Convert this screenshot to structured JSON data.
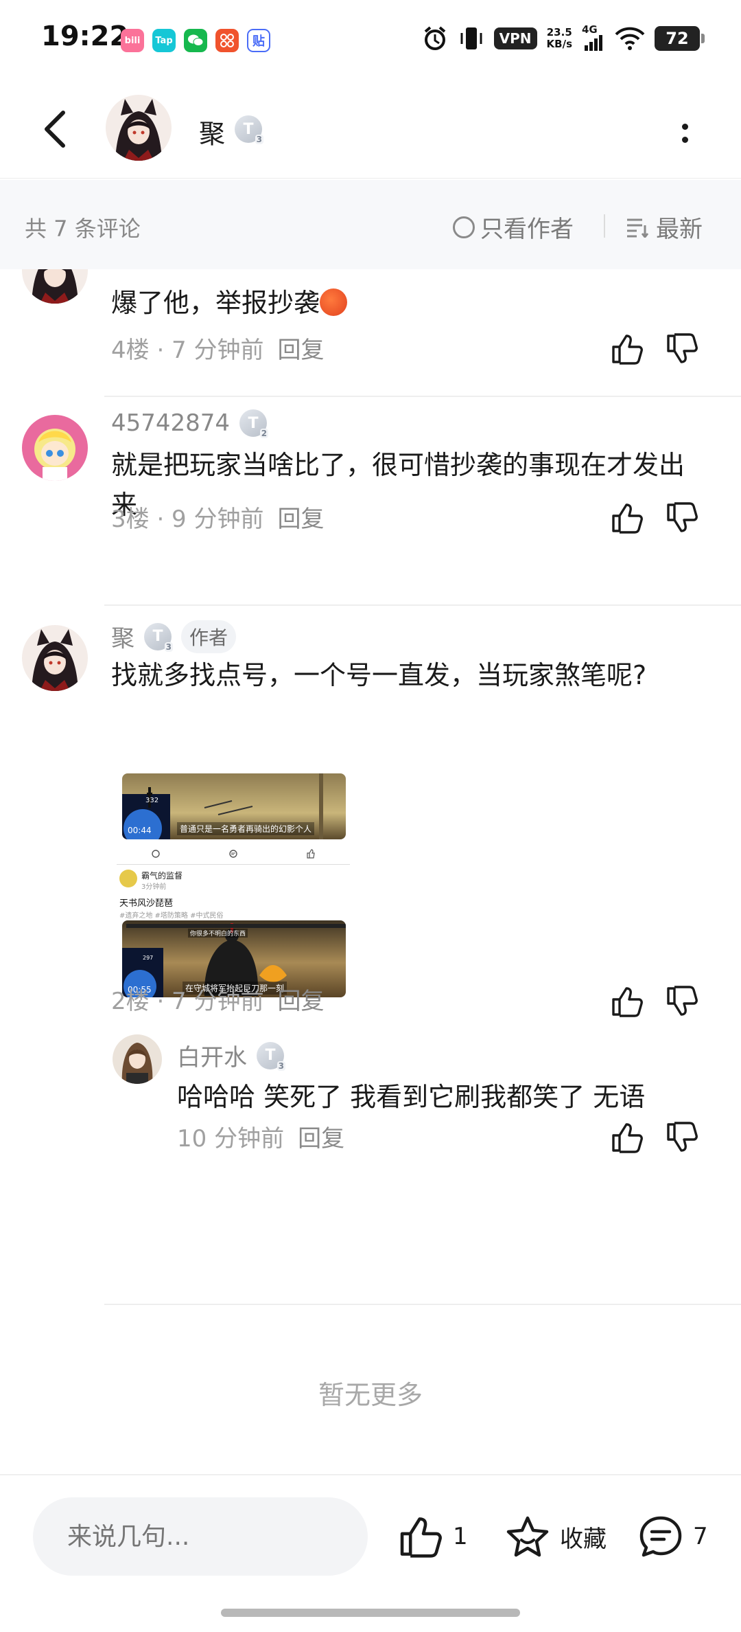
{
  "status_bar": {
    "time": "19:22",
    "apps": [
      {
        "name": "bilibili-app-icon",
        "label": "bili",
        "color": "#fb7299"
      },
      {
        "name": "taptap-app-icon",
        "label": "Tap",
        "color": "#16c7d6"
      },
      {
        "name": "wechat-app-icon",
        "label": "",
        "color": "#16b84e"
      },
      {
        "name": "app-grid-icon",
        "label": "",
        "color": "#f0532d"
      },
      {
        "name": "tieba-app-icon",
        "label": "贴",
        "color": "#4a6cf7"
      }
    ],
    "vpn": "VPN",
    "speed_value": "23.5",
    "speed_unit": "KB/s",
    "network": "4G",
    "battery": "72"
  },
  "header": {
    "name": "聚",
    "level": "3"
  },
  "toolbar": {
    "count": "共 7 条评论",
    "author_only": "只看作者",
    "sort": "最新"
  },
  "comments": [
    {
      "text": "爆了他，举报抄袭",
      "floor": "4楼 · 7 分钟前",
      "reply": "回复"
    },
    {
      "user": "45742874",
      "level": "2",
      "text": "就是把玩家当啥比了，很可惜抄袭的事现在才发出来",
      "floor": "3楼 · 9 分钟前",
      "reply": "回复"
    },
    {
      "user": "聚",
      "level": "3",
      "tag": "作者",
      "text": "找就多找点号，一个号一直发，当玩家煞笔呢?",
      "floor": "2楼 · 7 分钟前",
      "reply": "回复",
      "image": {
        "top_video_time": "00:44",
        "top_video_likes": "332",
        "top_caption": "普通只是一名勇者再骑出的幻影个人",
        "post_author": "霸气的监督",
        "post_time": "3分钟前",
        "post_title": "天书风沙琵琶",
        "post_tags": "#遗弃之地 #塔防策略 #中式民俗",
        "bottom_video_time": "00:55",
        "bottom_video_likes": "297",
        "bottom_sign": "你很多不明白的东西",
        "bottom_caption": "在守城将军抬起巨刀那一刻"
      }
    }
  ],
  "reply": {
    "user": "白开水",
    "level": "3",
    "text": "哈哈哈 笑死了 我看到它刷我都笑了 无语",
    "time": "10 分钟前",
    "reply": "回复"
  },
  "no_more": "暂无更多",
  "bottom_bar": {
    "input_placeholder": "来说几句...",
    "like_count": "1",
    "favorite_label": "收藏",
    "comment_count": "7"
  }
}
